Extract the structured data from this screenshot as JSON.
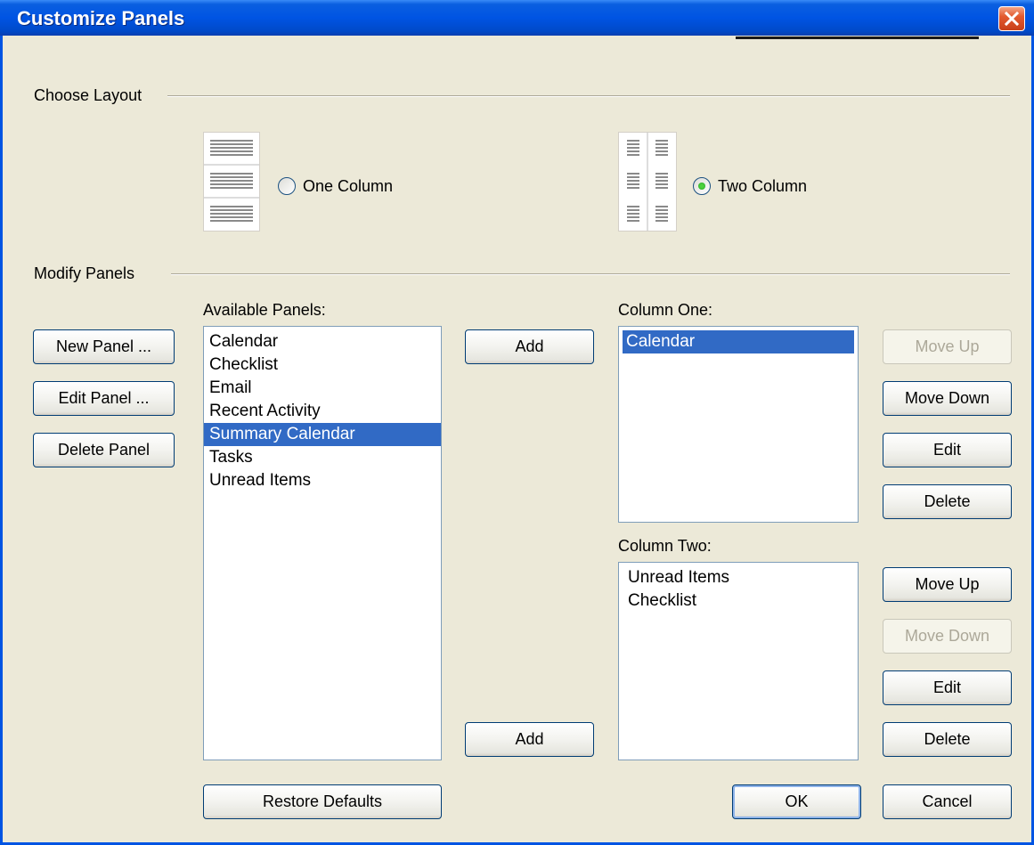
{
  "window": {
    "title": "Customize Panels"
  },
  "choose_layout": {
    "group_label": "Choose Layout",
    "one_column": {
      "label": "One Column",
      "checked": false
    },
    "two_column": {
      "label": "Two Column",
      "checked": true
    }
  },
  "modify_panels": {
    "group_label": "Modify Panels"
  },
  "left_buttons": {
    "new_panel": "New Panel ...",
    "edit_panel": "Edit Panel ...",
    "delete_panel": "Delete Panel"
  },
  "available_panels": {
    "label": "Available Panels:",
    "items": [
      "Calendar",
      "Checklist",
      "Email",
      "Recent Activity",
      "Summary Calendar",
      "Tasks",
      "Unread Items"
    ],
    "selected_index": 4
  },
  "add_buttons": {
    "add_one": "Add",
    "add_two": "Add"
  },
  "column_one": {
    "label": "Column One:",
    "items": [
      "Calendar"
    ],
    "selected_index": 0,
    "move_up": "Move Up",
    "move_down": "Move Down",
    "edit": "Edit",
    "delete": "Delete"
  },
  "column_two": {
    "label": "Column Two:",
    "items": [
      "Unread Items",
      "Checklist"
    ],
    "move_up": "Move Up",
    "move_down": "Move Down",
    "edit": "Edit",
    "delete": "Delete"
  },
  "footer": {
    "restore_defaults": "Restore Defaults",
    "ok": "OK",
    "cancel": "Cancel"
  },
  "colors": {
    "title_bar": "#0054e3",
    "selection": "#316ac5",
    "dialog_bg": "#ECE9D8",
    "close_button": "#e35a2f"
  }
}
